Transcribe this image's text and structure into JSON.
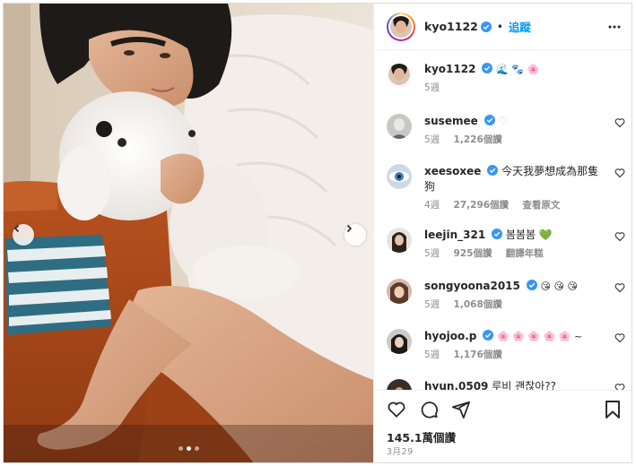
{
  "post": {
    "author": "kyo1122",
    "follow_sep": "•",
    "follow_label": "追蹤",
    "caption_emojis": "🌊 🐾 🌸",
    "caption_time": "5週",
    "likes": "145.1萬個讚",
    "date": "3月29",
    "carousel": {
      "total": 3,
      "current": 2
    }
  },
  "comments": [
    {
      "user": "susemee",
      "verified": true,
      "text": "♡",
      "time": "5週",
      "likes": "1,226個讚",
      "extra": ""
    },
    {
      "user": "xeesoxee",
      "verified": true,
      "text": "今天我夢想成為那隻狗",
      "time": "4週",
      "likes": "27,296個讚",
      "extra": "查看原文"
    },
    {
      "user": "leejin_321",
      "verified": true,
      "text": "봄봄봄 💚",
      "time": "5週",
      "likes": "925個讚",
      "extra": "翻譯年糕"
    },
    {
      "user": "songyoona2015",
      "verified": true,
      "text": "😘 😘 😘",
      "time": "5週",
      "likes": "1,068個讚",
      "extra": ""
    },
    {
      "user": "hyojoo.p",
      "verified": true,
      "text": "🌸 🌸 🌸 🌸 🌸 ~",
      "time": "5週",
      "likes": "1,176個讚",
      "extra": ""
    },
    {
      "user": "hyun.0509",
      "verified": false,
      "text": "루비 괜찮아??",
      "time": "",
      "likes": "",
      "extra": ""
    }
  ],
  "colors": {
    "accent": "#0095f6",
    "verified": "#3897f0",
    "muted": "#8e8e8e",
    "text": "#262626"
  },
  "icons": [
    "more-icon",
    "heart-icon",
    "comment-icon",
    "share-icon",
    "save-icon",
    "chevron-left-icon",
    "chevron-right-icon"
  ]
}
